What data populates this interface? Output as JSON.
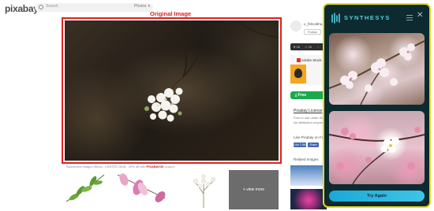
{
  "header": {
    "logo": "pixabay",
    "search_placeholder": "Search",
    "search_type": "Photos"
  },
  "main": {
    "overlay_label": "Original Image",
    "sponsor_text": "Sponsored Images iStock - LIMITED DEAL: 20% off with",
    "sponsor_code": "PIXABAY20",
    "sponsor_suffix": "coupon"
  },
  "related_strip": {
    "view_more": "+ view more"
  },
  "sidebar": {
    "author": "u_fs9ca5ha...",
    "follow": "Follow",
    "stats": [
      "♥ 28",
      "☆ 10",
      "◌"
    ],
    "ad_brand": "Adobe Stock",
    "free_download": "⤓ Free",
    "license_title": "Pixabay License",
    "license_lines": [
      "Free to use under the...",
      "No attribution required"
    ],
    "like_text": "Like Pixabay on Fa...",
    "like_btn": "Like 1.5M",
    "share_btn": "Share",
    "related_label": "Related Images"
  },
  "panel": {
    "brand": "SYNTHESYS",
    "try_again": "Try Again",
    "accent_color": "#e4d91b",
    "brand_color": "#4fd2e0",
    "icons": [
      "synthesys-logo-icon",
      "menu-icon",
      "close-icon"
    ]
  }
}
